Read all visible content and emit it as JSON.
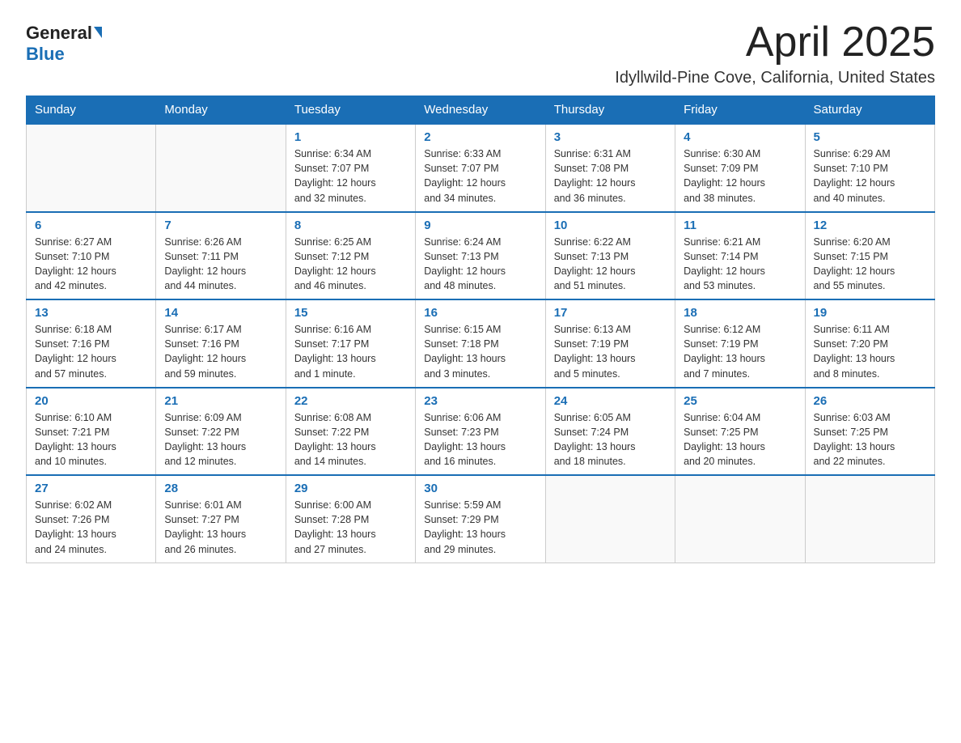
{
  "logo": {
    "general": "General",
    "blue": "Blue"
  },
  "header": {
    "month": "April 2025",
    "location": "Idyllwild-Pine Cove, California, United States"
  },
  "weekdays": [
    "Sunday",
    "Monday",
    "Tuesday",
    "Wednesday",
    "Thursday",
    "Friday",
    "Saturday"
  ],
  "weeks": [
    [
      {
        "day": "",
        "info": ""
      },
      {
        "day": "",
        "info": ""
      },
      {
        "day": "1",
        "info": "Sunrise: 6:34 AM\nSunset: 7:07 PM\nDaylight: 12 hours\nand 32 minutes."
      },
      {
        "day": "2",
        "info": "Sunrise: 6:33 AM\nSunset: 7:07 PM\nDaylight: 12 hours\nand 34 minutes."
      },
      {
        "day": "3",
        "info": "Sunrise: 6:31 AM\nSunset: 7:08 PM\nDaylight: 12 hours\nand 36 minutes."
      },
      {
        "day": "4",
        "info": "Sunrise: 6:30 AM\nSunset: 7:09 PM\nDaylight: 12 hours\nand 38 minutes."
      },
      {
        "day": "5",
        "info": "Sunrise: 6:29 AM\nSunset: 7:10 PM\nDaylight: 12 hours\nand 40 minutes."
      }
    ],
    [
      {
        "day": "6",
        "info": "Sunrise: 6:27 AM\nSunset: 7:10 PM\nDaylight: 12 hours\nand 42 minutes."
      },
      {
        "day": "7",
        "info": "Sunrise: 6:26 AM\nSunset: 7:11 PM\nDaylight: 12 hours\nand 44 minutes."
      },
      {
        "day": "8",
        "info": "Sunrise: 6:25 AM\nSunset: 7:12 PM\nDaylight: 12 hours\nand 46 minutes."
      },
      {
        "day": "9",
        "info": "Sunrise: 6:24 AM\nSunset: 7:13 PM\nDaylight: 12 hours\nand 48 minutes."
      },
      {
        "day": "10",
        "info": "Sunrise: 6:22 AM\nSunset: 7:13 PM\nDaylight: 12 hours\nand 51 minutes."
      },
      {
        "day": "11",
        "info": "Sunrise: 6:21 AM\nSunset: 7:14 PM\nDaylight: 12 hours\nand 53 minutes."
      },
      {
        "day": "12",
        "info": "Sunrise: 6:20 AM\nSunset: 7:15 PM\nDaylight: 12 hours\nand 55 minutes."
      }
    ],
    [
      {
        "day": "13",
        "info": "Sunrise: 6:18 AM\nSunset: 7:16 PM\nDaylight: 12 hours\nand 57 minutes."
      },
      {
        "day": "14",
        "info": "Sunrise: 6:17 AM\nSunset: 7:16 PM\nDaylight: 12 hours\nand 59 minutes."
      },
      {
        "day": "15",
        "info": "Sunrise: 6:16 AM\nSunset: 7:17 PM\nDaylight: 13 hours\nand 1 minute."
      },
      {
        "day": "16",
        "info": "Sunrise: 6:15 AM\nSunset: 7:18 PM\nDaylight: 13 hours\nand 3 minutes."
      },
      {
        "day": "17",
        "info": "Sunrise: 6:13 AM\nSunset: 7:19 PM\nDaylight: 13 hours\nand 5 minutes."
      },
      {
        "day": "18",
        "info": "Sunrise: 6:12 AM\nSunset: 7:19 PM\nDaylight: 13 hours\nand 7 minutes."
      },
      {
        "day": "19",
        "info": "Sunrise: 6:11 AM\nSunset: 7:20 PM\nDaylight: 13 hours\nand 8 minutes."
      }
    ],
    [
      {
        "day": "20",
        "info": "Sunrise: 6:10 AM\nSunset: 7:21 PM\nDaylight: 13 hours\nand 10 minutes."
      },
      {
        "day": "21",
        "info": "Sunrise: 6:09 AM\nSunset: 7:22 PM\nDaylight: 13 hours\nand 12 minutes."
      },
      {
        "day": "22",
        "info": "Sunrise: 6:08 AM\nSunset: 7:22 PM\nDaylight: 13 hours\nand 14 minutes."
      },
      {
        "day": "23",
        "info": "Sunrise: 6:06 AM\nSunset: 7:23 PM\nDaylight: 13 hours\nand 16 minutes."
      },
      {
        "day": "24",
        "info": "Sunrise: 6:05 AM\nSunset: 7:24 PM\nDaylight: 13 hours\nand 18 minutes."
      },
      {
        "day": "25",
        "info": "Sunrise: 6:04 AM\nSunset: 7:25 PM\nDaylight: 13 hours\nand 20 minutes."
      },
      {
        "day": "26",
        "info": "Sunrise: 6:03 AM\nSunset: 7:25 PM\nDaylight: 13 hours\nand 22 minutes."
      }
    ],
    [
      {
        "day": "27",
        "info": "Sunrise: 6:02 AM\nSunset: 7:26 PM\nDaylight: 13 hours\nand 24 minutes."
      },
      {
        "day": "28",
        "info": "Sunrise: 6:01 AM\nSunset: 7:27 PM\nDaylight: 13 hours\nand 26 minutes."
      },
      {
        "day": "29",
        "info": "Sunrise: 6:00 AM\nSunset: 7:28 PM\nDaylight: 13 hours\nand 27 minutes."
      },
      {
        "day": "30",
        "info": "Sunrise: 5:59 AM\nSunset: 7:29 PM\nDaylight: 13 hours\nand 29 minutes."
      },
      {
        "day": "",
        "info": ""
      },
      {
        "day": "",
        "info": ""
      },
      {
        "day": "",
        "info": ""
      }
    ]
  ]
}
